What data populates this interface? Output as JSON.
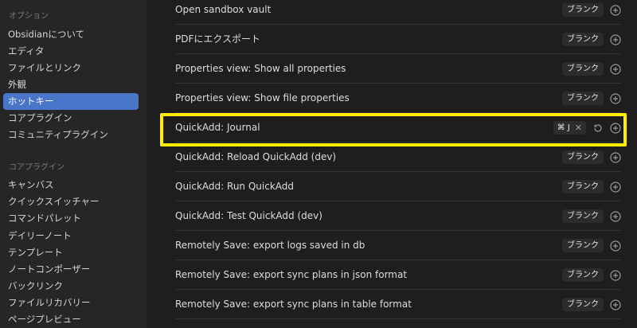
{
  "sidebar": {
    "options_title": "オプション",
    "options": [
      "Obsidianについて",
      "エディタ",
      "ファイルとリンク",
      "外観",
      "ホットキー",
      "コアプラグイン",
      "コミュニティプラグイン"
    ],
    "core_title": "コアプラグイン",
    "core": [
      "キャンバス",
      "クイックスイッチャー",
      "コマンドパレット",
      "デイリーノート",
      "テンプレート",
      "ノートコンポーザー",
      "バックリンク",
      "ファイルリカバリー",
      "ページプレビュー"
    ]
  },
  "hotkeys": {
    "blank_label": "ブランク",
    "rows": [
      {
        "label": "Open sandbox vault"
      },
      {
        "label": "PDFにエクスポート"
      },
      {
        "label": "Properties view: Show all properties"
      },
      {
        "label": "Properties view: Show file properties"
      },
      {
        "label": "QuickAdd: Journal",
        "hotkey": "⌘ J"
      },
      {
        "label": "QuickAdd: Reload QuickAdd (dev)"
      },
      {
        "label": "QuickAdd: Run QuickAdd"
      },
      {
        "label": "QuickAdd: Test QuickAdd (dev)"
      },
      {
        "label": "Remotely Save: export logs saved in db"
      },
      {
        "label": "Remotely Save: export sync plans in json format"
      },
      {
        "label": "Remotely Save: export sync plans in table format"
      }
    ]
  },
  "icons": {
    "add": "plus-circle-icon",
    "reset": "restore-icon",
    "remove": "close-icon"
  },
  "colors": {
    "active": "#4a76c9",
    "highlight": "#ffee00"
  }
}
